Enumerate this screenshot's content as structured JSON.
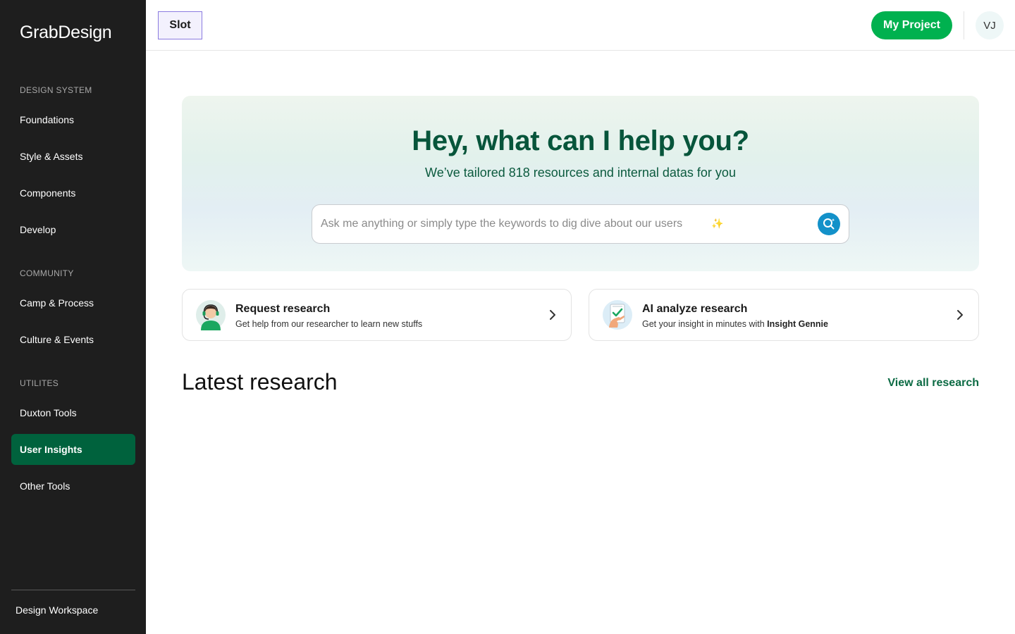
{
  "sidebar": {
    "logo_part1": "Grab",
    "logo_part2": "Design",
    "sections": [
      {
        "label": "DESIGN SYSTEM"
      },
      {
        "label": "COMMUNITY"
      },
      {
        "label": "UTILITES"
      }
    ],
    "items": [
      {
        "label": "Foundations"
      },
      {
        "label": "Style & Assets"
      },
      {
        "label": "Components"
      },
      {
        "label": "Develop"
      },
      {
        "label": "Camp & Process"
      },
      {
        "label": "Culture & Events"
      },
      {
        "label": "Duxton Tools"
      },
      {
        "label": "User Insights"
      },
      {
        "label": "Other Tools"
      }
    ],
    "active_item": "User Insights",
    "footer_label": "Design Workspace"
  },
  "header": {
    "slot_label": "Slot",
    "project_button": "My Project",
    "avatar_initials": "VJ"
  },
  "hero": {
    "title": "Hey, what can I help you?",
    "subtitle": "We’ve tailored 818 resources and internal datas for you",
    "search_placeholder": "Ask me anything or simply type the keywords to dig dive about our users",
    "search_value": ""
  },
  "cards": [
    {
      "title": "Request research",
      "description": "Get help from our researcher to learn new stuffs",
      "icon": "researcher-headset-icon"
    },
    {
      "title": "AI analyze research",
      "description_prefix": "Get your insight in minutes with ",
      "description_bold": "Insight Gennie",
      "icon": "ai-checklist-icon"
    }
  ],
  "latest": {
    "heading": "Latest research",
    "view_all": "View all research"
  },
  "colors": {
    "sidebar_bg": "#1e1e1e",
    "active_nav": "#00623d",
    "brand_green": "#00b14f",
    "hero_title": "#07553b",
    "search_button": "#1391c9",
    "link_green": "#0b6a43"
  }
}
